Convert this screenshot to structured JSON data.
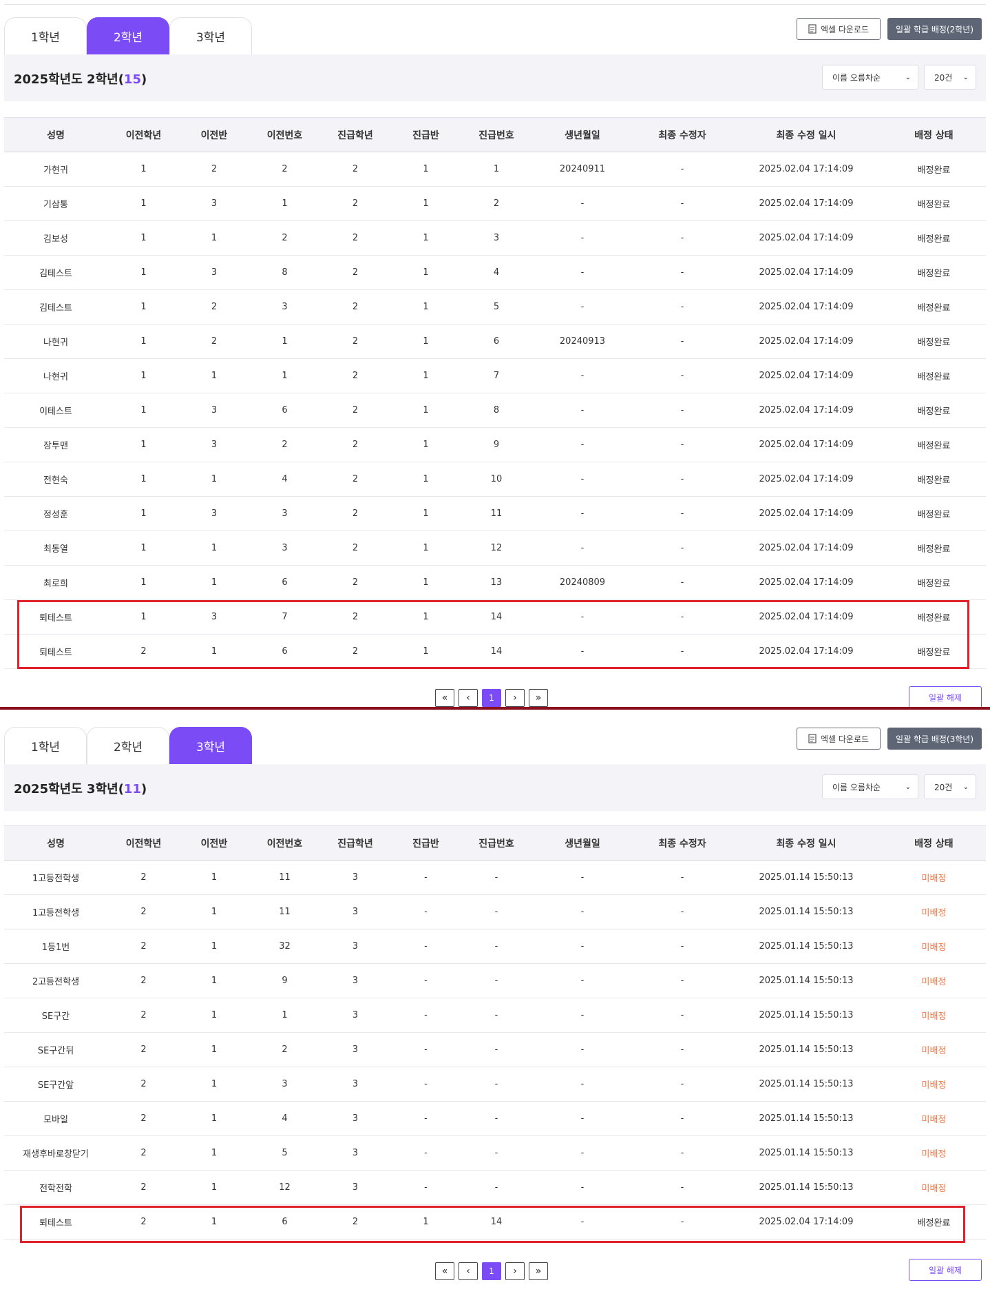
{
  "colors": {
    "accent": "#7b4cf5",
    "unassigned": "#f07a48",
    "highlight": "#e0202a",
    "dark_button": "#5e6676"
  },
  "columns": [
    "성명",
    "이전학년",
    "이전반",
    "이전번호",
    "진급학년",
    "진급반",
    "진급번호",
    "생년월일",
    "최종 수정자",
    "최종 수정 일시",
    "배정 상태"
  ],
  "tabs": [
    "1학년",
    "2학년",
    "3학년"
  ],
  "excel_label": "엑셀 다운로드",
  "release_label": "일괄 해제",
  "pagination": {
    "first": "«",
    "prev": "‹",
    "current": "1",
    "next": "›",
    "last": "»"
  },
  "panels": [
    {
      "active_tab": 1,
      "bulk_assign_label": "일괄 학급 배정(2학년)",
      "title_prefix": "2025학년도 2학년(",
      "count": "15",
      "title_suffix": ")",
      "sort_select": "이름 오름차순",
      "size_select": "20건",
      "rows": [
        [
          "가현귀",
          "1",
          "2",
          "2",
          "2",
          "1",
          "1",
          "20240911",
          "-",
          "2025.02.04 17:14:09",
          "배정완료"
        ],
        [
          "기삼통",
          "1",
          "3",
          "1",
          "2",
          "1",
          "2",
          "-",
          "-",
          "2025.02.04 17:14:09",
          "배정완료"
        ],
        [
          "김보성",
          "1",
          "1",
          "2",
          "2",
          "1",
          "3",
          "-",
          "-",
          "2025.02.04 17:14:09",
          "배정완료"
        ],
        [
          "김테스트",
          "1",
          "3",
          "8",
          "2",
          "1",
          "4",
          "-",
          "-",
          "2025.02.04 17:14:09",
          "배정완료"
        ],
        [
          "김테스트",
          "1",
          "2",
          "3",
          "2",
          "1",
          "5",
          "-",
          "-",
          "2025.02.04 17:14:09",
          "배정완료"
        ],
        [
          "나현귀",
          "1",
          "2",
          "1",
          "2",
          "1",
          "6",
          "20240913",
          "-",
          "2025.02.04 17:14:09",
          "배정완료"
        ],
        [
          "나현귀",
          "1",
          "1",
          "1",
          "2",
          "1",
          "7",
          "-",
          "-",
          "2025.02.04 17:14:09",
          "배정완료"
        ],
        [
          "이테스트",
          "1",
          "3",
          "6",
          "2",
          "1",
          "8",
          "-",
          "-",
          "2025.02.04 17:14:09",
          "배정완료"
        ],
        [
          "장투맨",
          "1",
          "3",
          "2",
          "2",
          "1",
          "9",
          "-",
          "-",
          "2025.02.04 17:14:09",
          "배정완료"
        ],
        [
          "전현숙",
          "1",
          "1",
          "4",
          "2",
          "1",
          "10",
          "-",
          "-",
          "2025.02.04 17:14:09",
          "배정완료"
        ],
        [
          "정성훈",
          "1",
          "3",
          "3",
          "2",
          "1",
          "11",
          "-",
          "-",
          "2025.02.04 17:14:09",
          "배정완료"
        ],
        [
          "최동열",
          "1",
          "1",
          "3",
          "2",
          "1",
          "12",
          "-",
          "-",
          "2025.02.04 17:14:09",
          "배정완료"
        ],
        [
          "최로희",
          "1",
          "1",
          "6",
          "2",
          "1",
          "13",
          "20240809",
          "-",
          "2025.02.04 17:14:09",
          "배정완료"
        ],
        [
          "퇴테스트",
          "1",
          "3",
          "7",
          "2",
          "1",
          "14",
          "-",
          "-",
          "2025.02.04 17:14:09",
          "배정완료"
        ],
        [
          "퇴테스트",
          "2",
          "1",
          "6",
          "2",
          "1",
          "14",
          "-",
          "-",
          "2025.02.04 17:14:09",
          "배정완료"
        ]
      ]
    },
    {
      "active_tab": 2,
      "bulk_assign_label": "일괄 학급 배정(3학년)",
      "title_prefix": "2025학년도 3학년(",
      "count": "11",
      "title_suffix": ")",
      "sort_select": "이름 오름차순",
      "size_select": "20건",
      "rows": [
        [
          "1고등전학생",
          "2",
          "1",
          "11",
          "3",
          "-",
          "-",
          "-",
          "-",
          "2025.01.14 15:50:13",
          "미배정"
        ],
        [
          "1고등전학생",
          "2",
          "1",
          "11",
          "3",
          "-",
          "-",
          "-",
          "-",
          "2025.01.14 15:50:13",
          "미배정"
        ],
        [
          "1등1번",
          "2",
          "1",
          "32",
          "3",
          "-",
          "-",
          "-",
          "-",
          "2025.01.14 15:50:13",
          "미배정"
        ],
        [
          "2고등전학생",
          "2",
          "1",
          "9",
          "3",
          "-",
          "-",
          "-",
          "-",
          "2025.01.14 15:50:13",
          "미배정"
        ],
        [
          "SE구간",
          "2",
          "1",
          "1",
          "3",
          "-",
          "-",
          "-",
          "-",
          "2025.01.14 15:50:13",
          "미배정"
        ],
        [
          "SE구간뒤",
          "2",
          "1",
          "2",
          "3",
          "-",
          "-",
          "-",
          "-",
          "2025.01.14 15:50:13",
          "미배정"
        ],
        [
          "SE구간앞",
          "2",
          "1",
          "3",
          "3",
          "-",
          "-",
          "-",
          "-",
          "2025.01.14 15:50:13",
          "미배정"
        ],
        [
          "모바일",
          "2",
          "1",
          "4",
          "3",
          "-",
          "-",
          "-",
          "-",
          "2025.01.14 15:50:13",
          "미배정"
        ],
        [
          "재생후바로창닫기",
          "2",
          "1",
          "5",
          "3",
          "-",
          "-",
          "-",
          "-",
          "2025.01.14 15:50:13",
          "미배정"
        ],
        [
          "전학전학",
          "2",
          "1",
          "12",
          "3",
          "-",
          "-",
          "-",
          "-",
          "2025.01.14 15:50:13",
          "미배정"
        ],
        [
          "퇴테스트",
          "2",
          "1",
          "6",
          "2",
          "1",
          "14",
          "-",
          "-",
          "2025.02.04 17:14:09",
          "배정완료"
        ]
      ]
    }
  ]
}
